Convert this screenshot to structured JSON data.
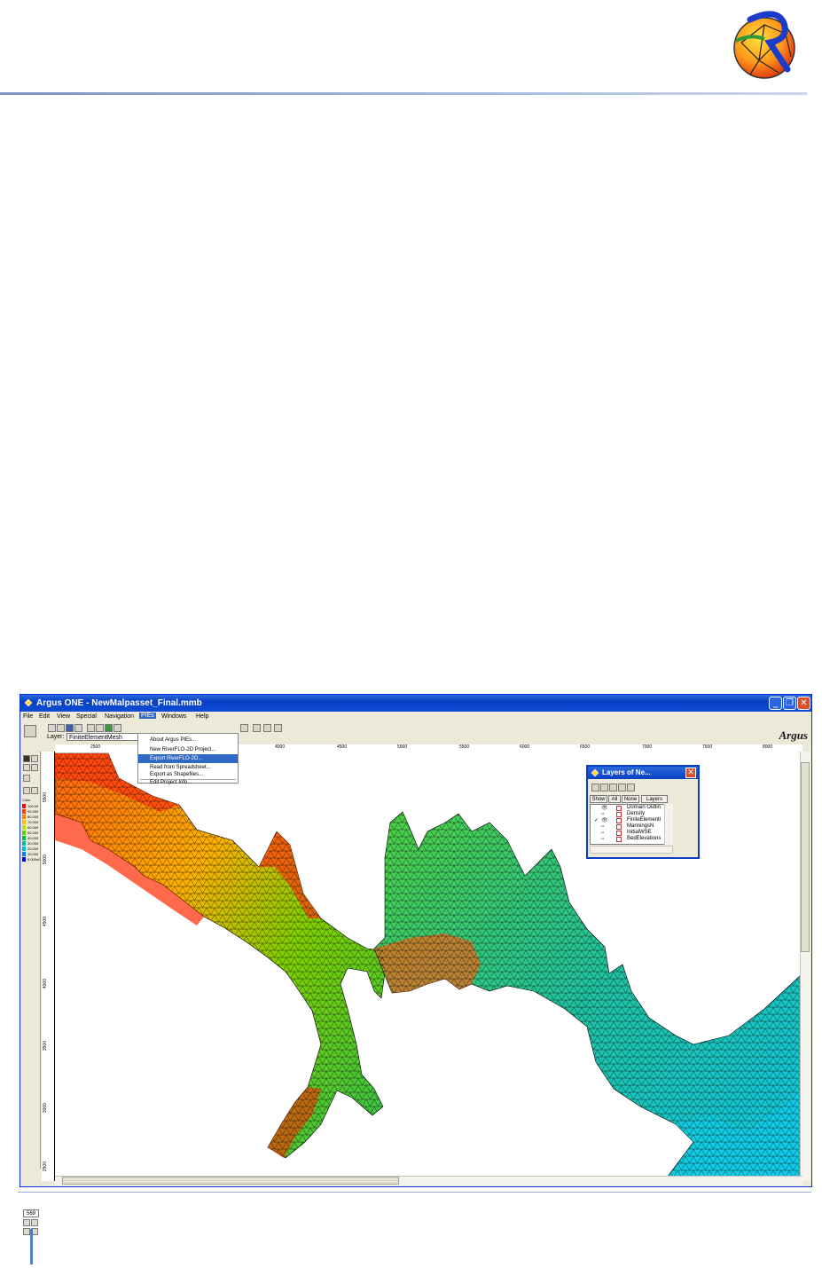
{
  "window": {
    "title": "Argus ONE - NewMalpasset_Final.mmb",
    "minimize": "_",
    "maximize": "❐",
    "close": "✕"
  },
  "menubar": {
    "items": [
      "File",
      "Edit",
      "View",
      "Special",
      "Navigation",
      "PIEs",
      "Windows",
      "Help"
    ],
    "active": "PIEs"
  },
  "pies_menu": {
    "items": [
      "About Argus PIEs...",
      "New RiverFLO-2D Project...",
      "Export RiverFLO-2D...",
      "Read from Spreadsheet...",
      "Export as Shapefiles...",
      "Edit Project Info..."
    ],
    "highlighted": "Export RiverFLO-2D..."
  },
  "toolbar": {
    "layer_label": "Layer:",
    "layer_value": "FiniteElementMesh",
    "brand": "Argus"
  },
  "ruler": {
    "top_ticks": [
      "2500",
      "3000",
      "3500",
      "4000",
      "4500",
      "5000",
      "5500",
      "6000",
      "6500",
      "7000",
      "7500",
      "8000"
    ],
    "left_ticks": [
      "5500",
      "5000",
      "4500",
      "4000",
      "3500",
      "3000",
      "2500"
    ]
  },
  "legend": {
    "header": "Color",
    "values": [
      "100.00",
      "90.000",
      "80.000",
      "70.000",
      "60.000",
      "50.000",
      "40.000",
      "30.000",
      "20.000",
      "10.000",
      "0.000e0"
    ],
    "colors": [
      "#ff0000",
      "#ff4000",
      "#ff8000",
      "#ffc000",
      "#c0e000",
      "#60d000",
      "#00c040",
      "#00c0a0",
      "#00c0e0",
      "#0080ff",
      "#0000ff"
    ]
  },
  "zoom_value": "569",
  "layers_palette": {
    "title": "Layers of Ne...",
    "buttons": [
      "Show",
      "All",
      "None",
      "Layers"
    ],
    "rows": [
      {
        "check": "",
        "name": "Domain Outlin"
      },
      {
        "check": "",
        "name": "Density"
      },
      {
        "check": "✓",
        "name": "FiniteElementI"
      },
      {
        "check": "",
        "name": "ManningsN"
      },
      {
        "check": "",
        "name": "InitialWSE"
      },
      {
        "check": "",
        "name": "BedElevations"
      }
    ]
  },
  "colors": {
    "accent": "#0a3fc4",
    "menu_highlight": "#316ac5",
    "header_rule": "#7c95bf"
  }
}
